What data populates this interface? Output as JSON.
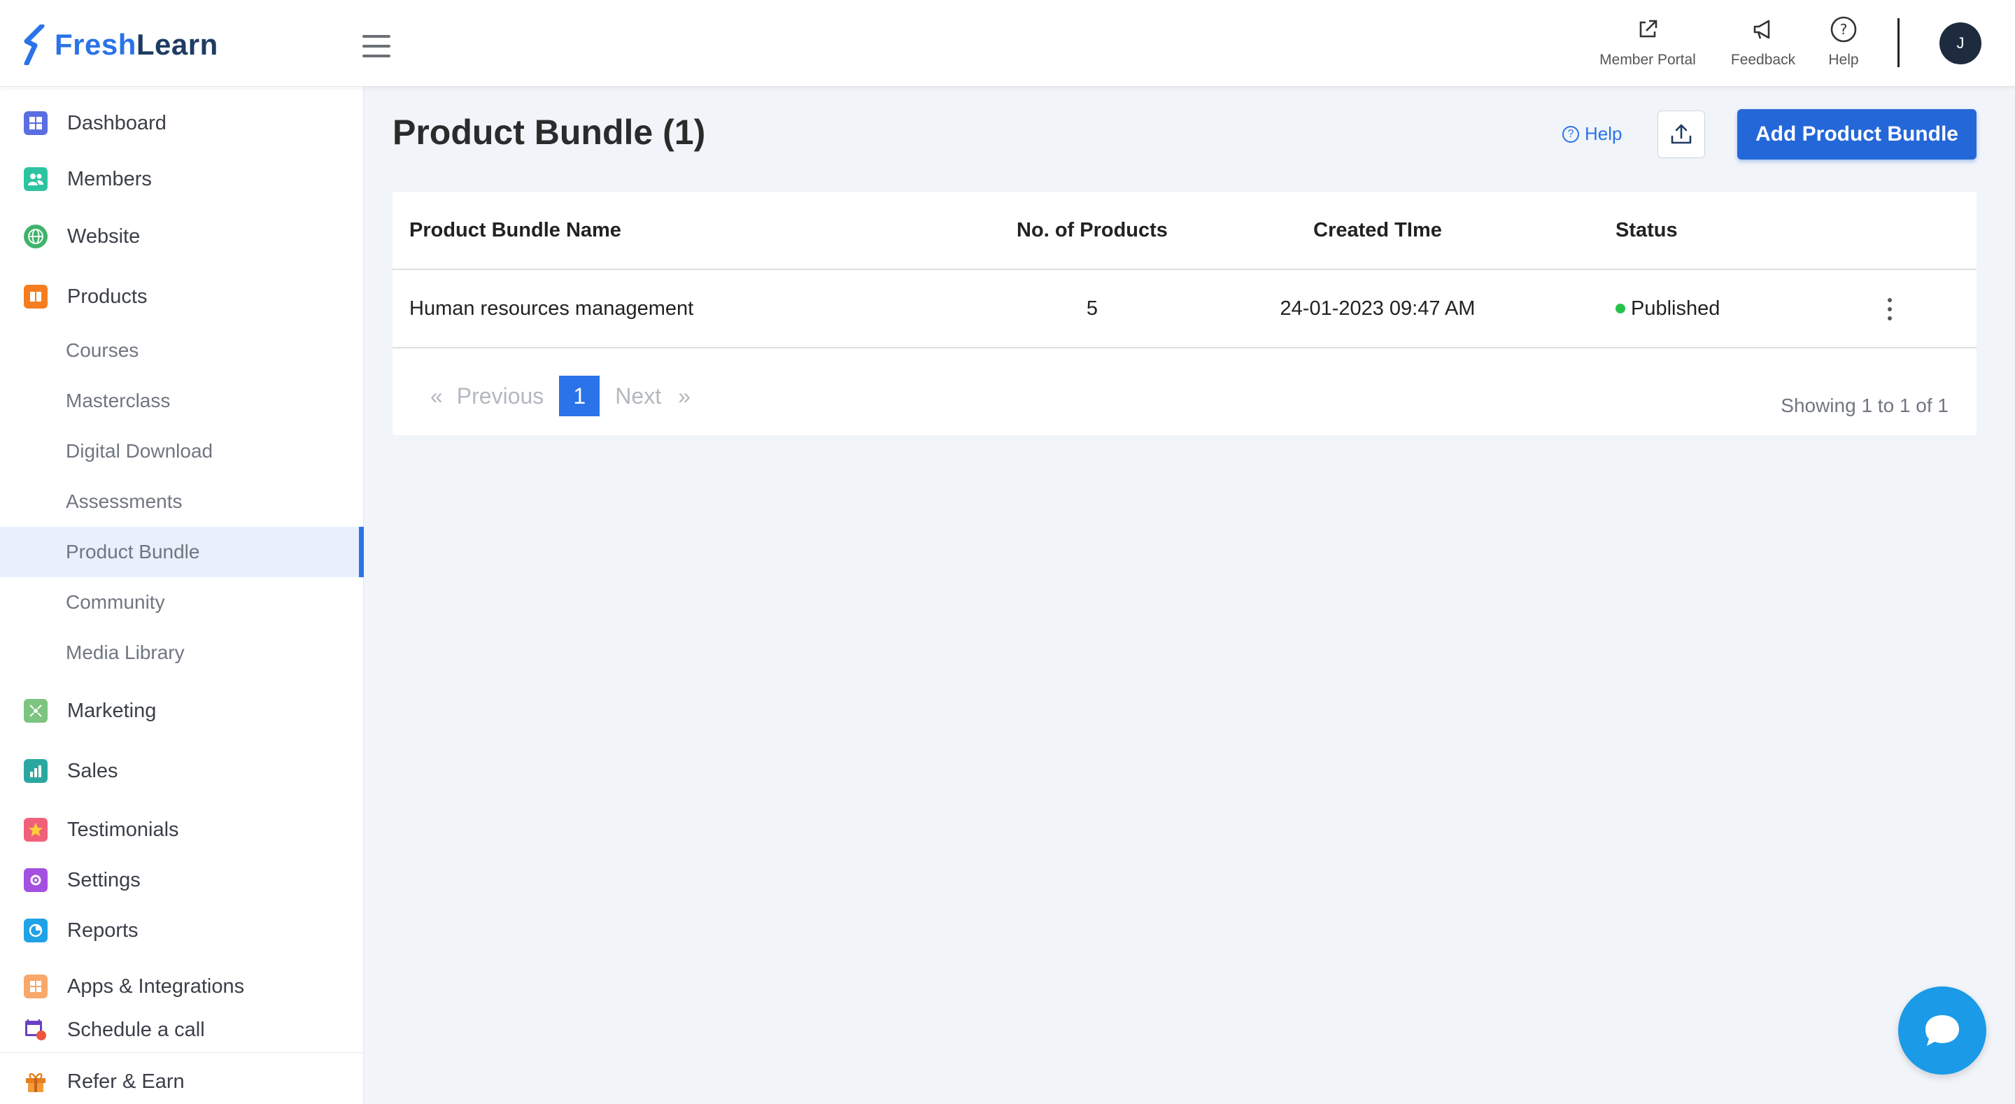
{
  "brand": {
    "part1": "Fresh",
    "part2": "Learn"
  },
  "header": {
    "member_portal_label": "Member Portal",
    "feedback_label": "Feedback",
    "help_label": "Help",
    "avatar_initial": "J"
  },
  "sidebar": {
    "items": [
      {
        "label": "Dashboard",
        "icon": "dashboard-icon"
      },
      {
        "label": "Members",
        "icon": "members-icon"
      },
      {
        "label": "Website",
        "icon": "globe-icon"
      },
      {
        "label": "Products",
        "icon": "book-icon"
      }
    ],
    "products_sub": [
      {
        "label": "Courses"
      },
      {
        "label": "Masterclass"
      },
      {
        "label": "Digital Download"
      },
      {
        "label": "Assessments"
      },
      {
        "label": "Product Bundle",
        "active": true
      },
      {
        "label": "Community"
      },
      {
        "label": "Media Library"
      }
    ],
    "lower_items": [
      {
        "label": "Marketing",
        "icon": "marketing-icon"
      },
      {
        "label": "Sales",
        "icon": "chart-icon"
      },
      {
        "label": "Testimonials",
        "icon": "star-icon"
      },
      {
        "label": "Settings",
        "icon": "gear-icon"
      },
      {
        "label": "Reports",
        "icon": "pie-icon"
      },
      {
        "label": "Apps & Integrations",
        "icon": "apps-icon"
      },
      {
        "label": "Schedule a call",
        "icon": "calendar-icon"
      }
    ],
    "refer": {
      "label": "Refer & Earn",
      "icon": "gift-icon"
    }
  },
  "main": {
    "title": "Product Bundle (1)",
    "help_link": "Help",
    "add_button": "Add Product Bundle",
    "table": {
      "columns": [
        "Product Bundle Name",
        "No. of Products",
        "Created TIme",
        "Status"
      ],
      "rows": [
        {
          "name": "Human resources management",
          "count": "5",
          "created": "24-01-2023 09:47 AM",
          "status": "Published"
        }
      ]
    },
    "pagination": {
      "first": "«",
      "previous": "Previous",
      "current": "1",
      "next": "Next",
      "last": "»",
      "showing": "Showing 1 to 1 of 1"
    }
  },
  "colors": {
    "accent": "#2a73e8",
    "primary_button": "#2467d8",
    "published": "#27c24c",
    "chat": "#1b9ae8"
  }
}
